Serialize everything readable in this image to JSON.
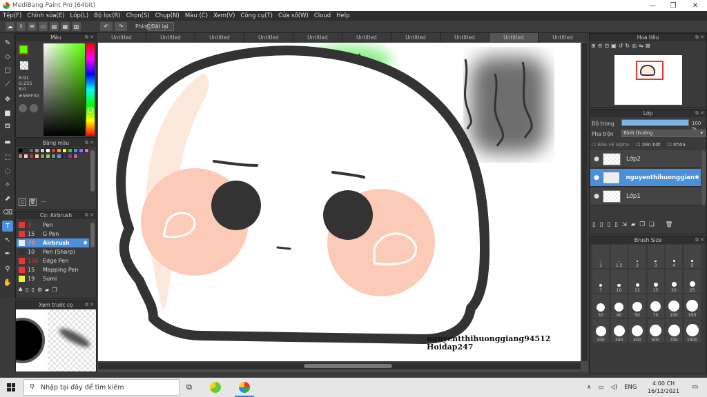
{
  "window": {
    "title": "MediBang Paint Pro (64bit)",
    "minimize": "—",
    "maximize": "❐",
    "close": "✕"
  },
  "menu": [
    "Tệp(F)",
    "Chỉnh sửa(E)",
    "Lớp(L)",
    "Bộ lọc(R)",
    "Chọn(S)",
    "Chụp(N)",
    "Màu (C)",
    "Xem(V)",
    "Công cụ(T)",
    "Cửa sổ(W)",
    "Cloud",
    "Help"
  ],
  "toolbar": {
    "shortcut_label": "Phím",
    "reset_label": "Đặt lại"
  },
  "color_panel": {
    "title": "Màu",
    "readout": [
      "R:91",
      "G:255",
      "B:0"
    ],
    "hex": "#5BFF00",
    "primary": "#5bff00",
    "secondary": "#000000"
  },
  "palette_panel": {
    "title": "Bảng màu",
    "footer": "---",
    "colors": [
      "#000",
      "#333",
      "#666",
      "#999",
      "#ccc",
      "#fff",
      "#e33",
      "#f90",
      "#ff0",
      "#3c3",
      "#39f",
      "#96f",
      "#f6c",
      "#b85",
      "#fcc",
      "#c33",
      "#fc9",
      "#996",
      "#9c6",
      "#699",
      "#69c",
      "#336",
      "#939",
      "#c69"
    ]
  },
  "brush_panel": {
    "title": "Cọ: Airbrush",
    "items": [
      {
        "size": "3",
        "name": "Pen",
        "color": "#e33"
      },
      {
        "size": "15",
        "name": "G Pen",
        "color": "#e33"
      },
      {
        "size": "70",
        "name": "Airbrush",
        "color": "#eee"
      },
      {
        "size": "10",
        "name": "Pen (Sharp)",
        "color": "#333"
      },
      {
        "size": "150",
        "name": "Edge Pen",
        "color": "#e33"
      },
      {
        "size": "15",
        "name": "Mapping Pen",
        "color": "#e33"
      },
      {
        "size": "19",
        "name": "Sumi",
        "color": "#ee3"
      }
    ]
  },
  "preview_panel": {
    "title": "Xem trước cọ"
  },
  "tabs": [
    "Untitled",
    "Untitled",
    "Untitled",
    "Untitled",
    "Untitled",
    "Untitled",
    "Untitled",
    "Untitled",
    "Untitled",
    "Untitled"
  ],
  "canvas": {
    "watermark_line1": "nguyentthihuonggiang94512",
    "watermark_line2": "Hoidap247"
  },
  "navigator_panel": {
    "title": "Hoa tiêu"
  },
  "layer_panel": {
    "title": "Lớp",
    "opacity_label": "Độ trong",
    "opacity_value": "100 %",
    "opacity_fraction": 1.0,
    "blend_label": "Pha trộn",
    "blend_value": "Bình thường",
    "protect_alpha": "Bảo vệ alpha",
    "clipping": "Xén bớt",
    "lock": "Khóa",
    "layers": [
      {
        "name": "Lớp2"
      },
      {
        "name": "nguyenthihuonggian"
      },
      {
        "name": "Lớp1"
      }
    ]
  },
  "brush_size_panel": {
    "title": "Brush Size",
    "sizes": [
      "1",
      "1.5",
      "2",
      "3",
      "4",
      "5",
      "7",
      "10",
      "12",
      "15",
      "20",
      "25",
      "30",
      "40",
      "50",
      "70",
      "100",
      "150",
      "200",
      "300",
      "400",
      "500",
      "700",
      "1000"
    ]
  },
  "taskbar": {
    "search_placeholder": "Nhập tại đây để tìm kiếm",
    "lang": "ENG",
    "time": "4:00 CH",
    "date": "16/12/2021"
  }
}
